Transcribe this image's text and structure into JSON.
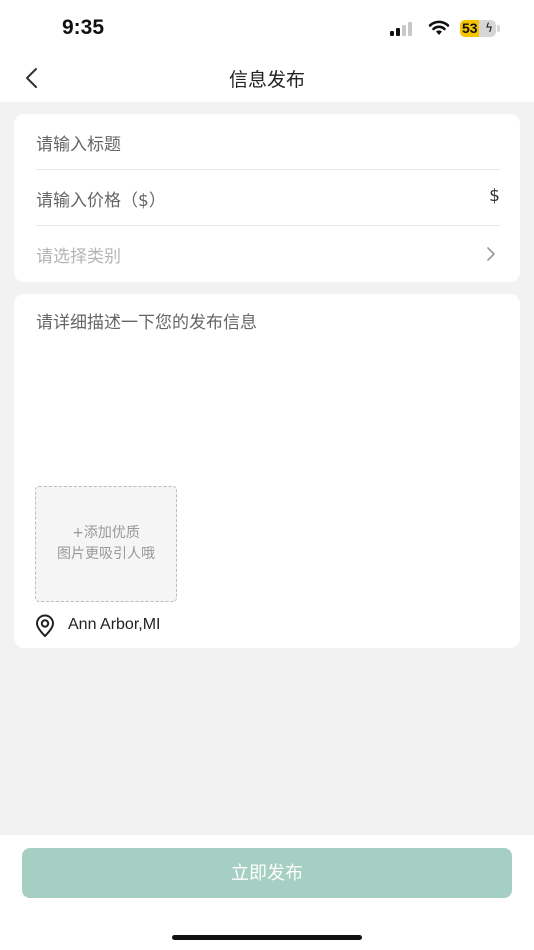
{
  "status_bar": {
    "time": "9:35",
    "battery_level": "53",
    "battery_fraction": 0.53,
    "icons": [
      "cellular-signal-icon",
      "wifi-icon",
      "battery-charging-icon"
    ]
  },
  "nav": {
    "title": "信息发布",
    "back_icon": "chevron-left-icon"
  },
  "form": {
    "title_placeholder": "请输入标题",
    "price_placeholder": "请输入价格（$）",
    "price_suffix": "$",
    "category_placeholder": "请选择类别",
    "description_placeholder": "请详细描述一下您的发布信息",
    "add_photo_line1": "+添加优质",
    "add_photo_line2": "图片更吸引人哦",
    "location": "Ann Arbor,MI",
    "location_icon": "location-pin-icon"
  },
  "footer": {
    "publish_label": "立即发布"
  },
  "colors": {
    "accent": "#a6cfc3",
    "background": "#f2f2f2",
    "battery": "#f7c500"
  }
}
